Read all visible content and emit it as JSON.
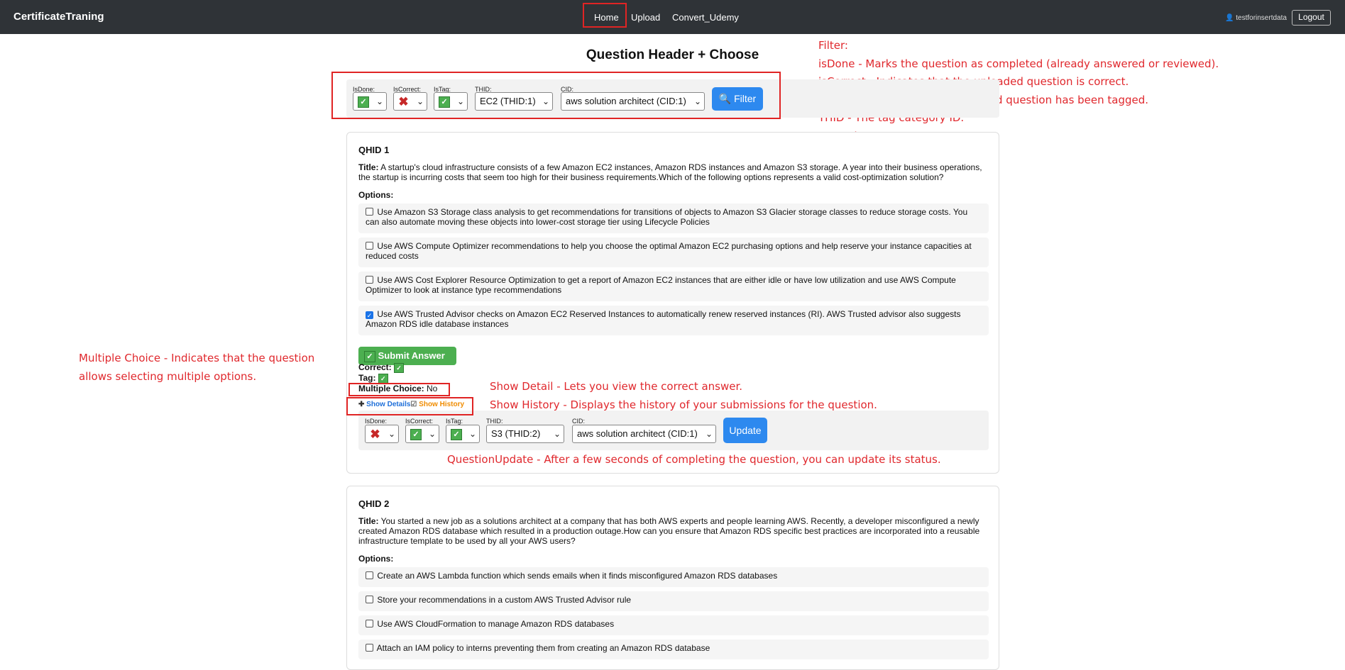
{
  "nav": {
    "brand": "CertificateTraning",
    "links": [
      "Home",
      "Upload",
      "Convert_Udemy"
    ],
    "user": "testforinsertdata",
    "user_icon": "user-icon",
    "logout": "Logout"
  },
  "page_title": "Question Header + Choose",
  "filter": {
    "isdone_label": "IsDone:",
    "iscorrect_label": "IsCorrect:",
    "istag_label": "IsTag:",
    "thid_label": "THID:",
    "thid_value": "EC2 (THID:1)",
    "cid_label": "CID:",
    "cid_value": "aws solution architect (CID:1)",
    "button": "Filter"
  },
  "annotations": {
    "filter_title": "Filter:",
    "filter_lines": [
      "isDone - Marks the question as completed (already answered or reviewed).",
      "isCorrect - Indicates that the uploaded question is correct.",
      "isTag - Indicates that the uploaded question has been tagged.",
      "THID - The tag category ID.",
      "CID - The category ID."
    ],
    "multiple_choice": [
      "Multiple Choice - Indicates that the question",
      "allows selecting multiple options."
    ],
    "show_detail": "Show Detail - Lets you view the correct answer.",
    "show_history": "Show History - Displays the history of your submissions for the question.",
    "question_update": "QuestionUpdate - After a few seconds of completing the question, you can update its status."
  },
  "questions": [
    {
      "qhid": "QHID 1",
      "title_label": "Title:",
      "title": "A startup's cloud infrastructure consists of a few Amazon EC2 instances, Amazon RDS instances and Amazon S3 storage. A year into their business operations, the startup is incurring costs that seem too high for their business requirements.Which of the following options represents a valid cost-optimization solution?",
      "options_label": "Options:",
      "options": [
        {
          "text": "Use Amazon S3 Storage class analysis to get recommendations for transitions of objects to Amazon S3 Glacier storage classes to reduce storage costs. You can also automate moving these objects into lower-cost storage tier using Lifecycle Policies",
          "checked": false
        },
        {
          "text": "Use AWS Compute Optimizer recommendations to help you choose the optimal Amazon EC2 purchasing options and help reserve your instance capacities at reduced costs",
          "checked": false
        },
        {
          "text": "Use AWS Cost Explorer Resource Optimization to get a report of Amazon EC2 instances that are either idle or have low utilization and use AWS Compute Optimizer to look at instance type recommendations",
          "checked": false
        },
        {
          "text": "Use AWS Trusted Advisor checks on Amazon EC2 Reserved Instances to automatically renew reserved instances (RI). AWS Trusted advisor also suggests Amazon RDS idle database instances",
          "checked": true
        }
      ],
      "submit": "Submit Answer",
      "correct_label": "Correct:",
      "tag_label": "Tag:",
      "multiple_choice_label": "Multiple Choice:",
      "multiple_choice_value": "No",
      "show_details": "Show Details",
      "show_history": "Show History",
      "update": {
        "isdone_label": "IsDone:",
        "iscorrect_label": "IsCorrect:",
        "istag_label": "IsTag:",
        "thid_label": "THID:",
        "thid_value": "S3 (THID:2)",
        "cid_label": "CID:",
        "cid_value": "aws solution architect (CID:1)",
        "button": "Update"
      }
    },
    {
      "qhid": "QHID 2",
      "title_label": "Title:",
      "title": "You started a new job as a solutions architect at a company that has both AWS experts and people learning AWS. Recently, a developer misconfigured a newly created Amazon RDS database which resulted in a production outage.How can you ensure that Amazon RDS specific best practices are incorporated into a reusable infrastructure template to be used by all your AWS users?",
      "options_label": "Options:",
      "options": [
        {
          "text": "Create an AWS Lambda function which sends emails when it finds misconfigured Amazon RDS databases",
          "checked": false
        },
        {
          "text": "Store your recommendations in a custom AWS Trusted Advisor rule",
          "checked": false
        },
        {
          "text": "Use AWS CloudFormation to manage Amazon RDS databases",
          "checked": false
        },
        {
          "text": "Attach an IAM policy to interns preventing them from creating an Amazon RDS database",
          "checked": false
        }
      ]
    }
  ]
}
